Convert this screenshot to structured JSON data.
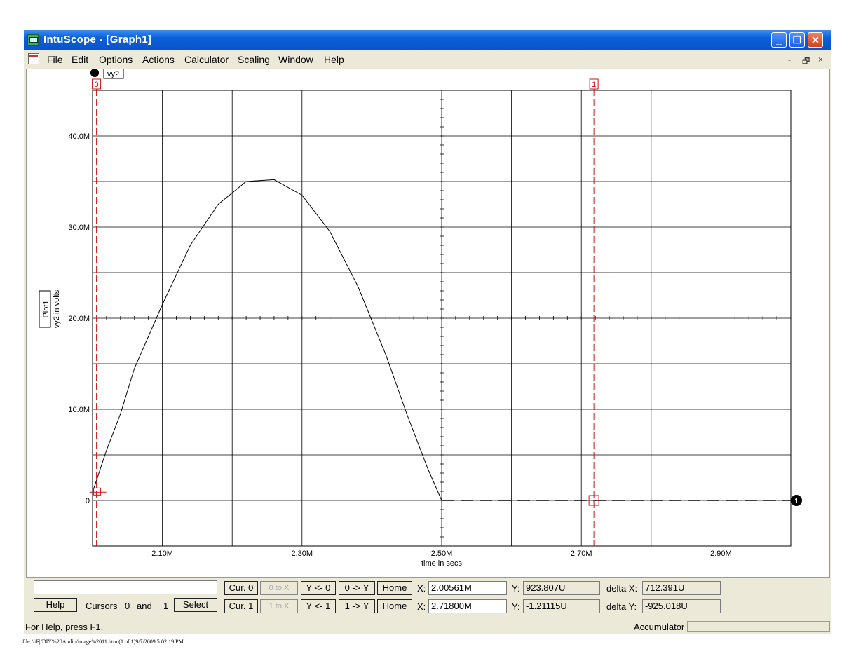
{
  "window": {
    "title": "IntuScope - [Graph1]"
  },
  "menu": [
    "File",
    "Edit",
    "Options",
    "Actions",
    "Calculator",
    "Scaling",
    "Window",
    "Help"
  ],
  "mdi_controls": {
    "minimize": "-",
    "restore": "🗗",
    "close": "×"
  },
  "chart_data": {
    "type": "line",
    "plot_label": "Plot1",
    "ylabel": "vy2 in volts",
    "xlabel": "time in secs",
    "trace_label": "vy2",
    "trace_marker": "1",
    "xlim": [
      2.0,
      3.0
    ],
    "ylim": [
      -5.0,
      45.0
    ],
    "x_tick_labels": [
      "2.10M",
      "2.30M",
      "2.50M",
      "2.70M",
      "2.90M"
    ],
    "x_tick_values": [
      2.1,
      2.3,
      2.5,
      2.7,
      2.9
    ],
    "y_tick_labels": [
      "0",
      "10.0M",
      "20.0M",
      "30.0M",
      "40.0M"
    ],
    "y_tick_values": [
      0,
      10,
      20,
      30,
      40
    ],
    "grid": true,
    "series": [
      {
        "values_x": [
          2.0,
          2.02,
          2.04,
          2.06,
          2.08,
          2.1,
          2.14,
          2.18,
          2.22,
          2.26,
          2.3,
          2.34,
          2.38,
          2.42,
          2.45,
          2.48,
          2.5,
          2.6,
          2.7,
          2.8,
          2.9,
          3.0
        ],
        "values_y": [
          0.9,
          5.5,
          9.5,
          14.5,
          18.0,
          21.5,
          28.0,
          32.5,
          35.0,
          35.2,
          33.5,
          29.5,
          23.5,
          16.0,
          9.5,
          3.5,
          0.0,
          -0.05,
          -0.02,
          -0.03,
          -0.02,
          -0.01
        ]
      }
    ],
    "cursors": [
      {
        "label": "0",
        "x": 2.00561,
        "y": 0.9
      },
      {
        "label": "1",
        "x": 2.718,
        "y": 0.0
      }
    ]
  },
  "panel": {
    "text_field": "",
    "help": "Help",
    "cursors_label": "Cursors",
    "cursor_a": "0",
    "and_label": "and",
    "cursor_b": "1",
    "select": "Select",
    "row0": {
      "cur": "Cur. 0",
      "to_x": "0 to X",
      "y_from": "Y <- 0",
      "to_y": "0 -> Y",
      "home": "Home",
      "x_label": "X:",
      "x": "2.00561M",
      "y_label": "Y:",
      "y": "923.807U",
      "delta_label": "delta X:",
      "delta": "712.391U"
    },
    "row1": {
      "cur": "Cur. 1",
      "to_x": "1 to X",
      "y_from": "Y <- 1",
      "to_y": "1 -> Y",
      "home": "Home",
      "x_label": "X:",
      "x": "2.71800M",
      "y_label": "Y:",
      "y": "-1.21115U",
      "delta_label": "delta Y:",
      "delta": "-925.018U"
    }
  },
  "status": {
    "help": "For Help, press F1.",
    "accumulator": "Accumulator"
  },
  "footer": "file:///F|/DIY%20Audio/image%2011.htm (1 of 1)9/7/2009 5:02:19 PM",
  "colors": {
    "cursor": "#d01010",
    "titlebar": "#0a5fd8",
    "trace": "#000000"
  }
}
